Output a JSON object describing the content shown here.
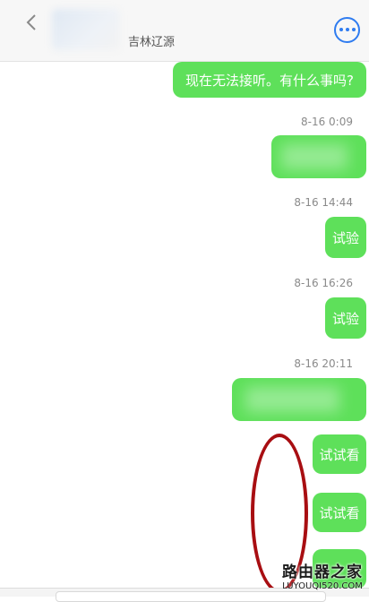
{
  "header": {
    "back_icon": "chevron-left-icon",
    "contact_sub": "吉林辽源",
    "more_icon": "more-dots-icon",
    "accent": "#2f7cf0"
  },
  "colors": {
    "bubble": "#5ee05a",
    "timestamp": "#8a8a8a",
    "annotation": "#a80e12"
  },
  "messages": [
    {
      "type": "text",
      "text": "现在无法接听。有什么事吗?"
    },
    {
      "type": "timestamp",
      "text": "8-16 0:09"
    },
    {
      "type": "blurred",
      "text": ""
    },
    {
      "type": "timestamp",
      "text": "8-16 14:44"
    },
    {
      "type": "text",
      "text": "试验"
    },
    {
      "type": "timestamp",
      "text": "8-16 16:26"
    },
    {
      "type": "text",
      "text": "试验"
    },
    {
      "type": "timestamp",
      "text": "8-16 20:11"
    },
    {
      "type": "blurred",
      "text": ""
    },
    {
      "type": "text",
      "text": "试试看"
    },
    {
      "type": "text",
      "text": "试试看"
    }
  ],
  "watermark": {
    "title": "路由器之家",
    "url": "LUYOUQI520.COM"
  }
}
